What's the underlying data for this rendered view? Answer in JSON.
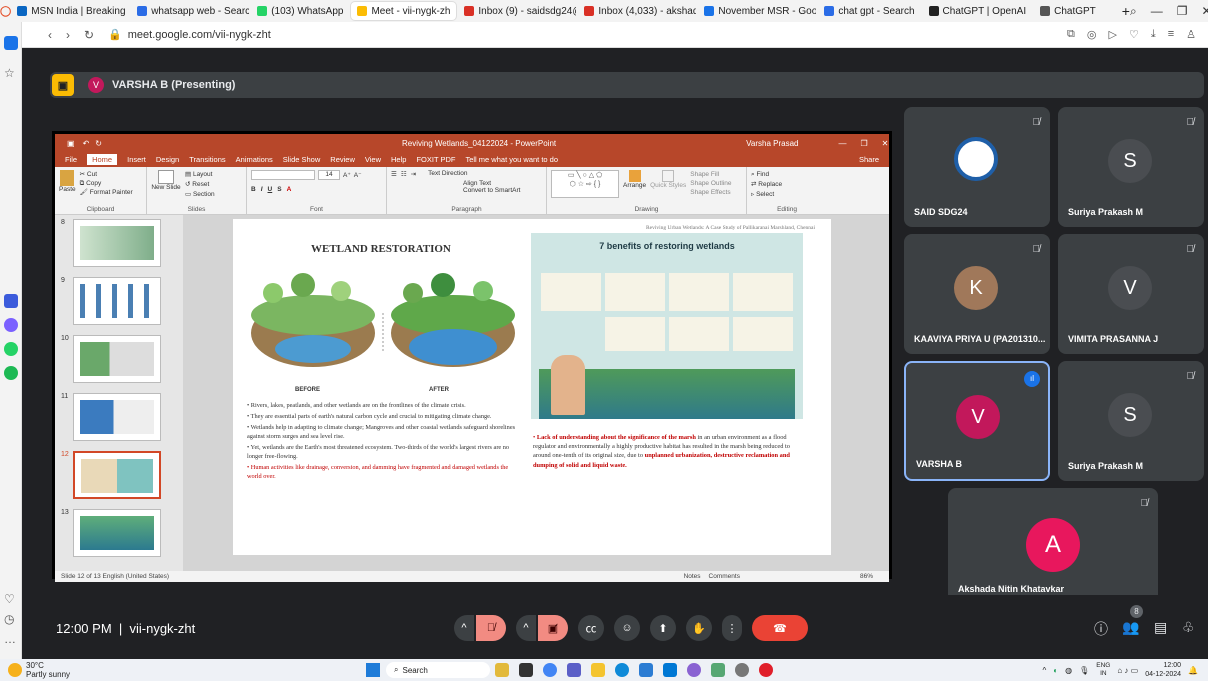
{
  "browser_tabs": [
    {
      "label": "MSN India | Breaking Ne",
      "color": "#0a66c2"
    },
    {
      "label": "whatsapp web - Search",
      "color": "#2b6ce6"
    },
    {
      "label": "(103) WhatsApp",
      "color": "#25d366"
    },
    {
      "label": "Meet - vii-nygk-zh",
      "color": "#fbbc04",
      "active": true
    },
    {
      "label": "Inbox (9) - saidsdg24@",
      "color": "#d93025"
    },
    {
      "label": "Inbox (4,033) - akshada",
      "color": "#d93025"
    },
    {
      "label": "November MSR - Goog",
      "color": "#1a73e8"
    },
    {
      "label": "chat gpt - Search",
      "color": "#2b6ce6"
    },
    {
      "label": "ChatGPT | OpenAI",
      "color": "#222222"
    },
    {
      "label": "ChatGPT",
      "color": "#555555"
    }
  ],
  "address": {
    "url": "meet.google.com/vii-nygk-zht"
  },
  "presenting": {
    "initial": "V",
    "label": "VARSHA B (Presenting)"
  },
  "ppt": {
    "title": "Reviving Wetlands_04122024 - PowerPoint",
    "user": "Varsha Prasad",
    "menu": [
      "File",
      "Home",
      "Insert",
      "Design",
      "Transitions",
      "Animations",
      "Slide Show",
      "Review",
      "View",
      "Help",
      "FOXIT PDF",
      "Tell me what you want to do"
    ],
    "share": "Share",
    "ribbon_groups": [
      "Clipboard",
      "Slides",
      "Font",
      "Paragraph",
      "Drawing",
      "Editing"
    ],
    "ribbon_items": {
      "paste": "Paste",
      "cut": "Cut",
      "copy": "Copy",
      "format_painter": "Format Painter",
      "new_slide": "New Slide",
      "layout": "Layout",
      "reset": "Reset",
      "section": "Section",
      "font_size": "14",
      "text_direction": "Text Direction",
      "align_text": "Align Text",
      "convert_smartart": "Convert to SmartArt",
      "arrange": "Arrange",
      "quick_styles": "Quick Styles",
      "shape_fill": "Shape Fill",
      "shape_outline": "Shape Outline",
      "shape_effects": "Shape Effects",
      "find": "Find",
      "replace": "Replace",
      "select": "Select"
    },
    "thumb_numbers": [
      "8",
      "9",
      "10",
      "11",
      "12",
      "13"
    ],
    "status": "Slide 12 of 13    English (United States)",
    "status_right": {
      "notes": "Notes",
      "comments": "Comments",
      "zoom": "86%"
    },
    "slide": {
      "ref": "Reviving Urban Wetlands: A Case Study of Pallikaranai Marshland, Chennai",
      "left_title": "WETLAND RESTORATION",
      "before": "BEFORE",
      "after": "AFTER",
      "right_title": "7 benefits of restoring wetlands",
      "bullets": [
        "Rivers, lakes, peatlands, and other wetlands are on the frontlines of the climate crisis.",
        "They are essential parts of earth's natural carbon cycle and crucial to mitigating climate change.",
        "Wetlands help in adapting to climate change; Mangroves and other coastal wetlands safeguard shorelines against storm surges and sea level rise.",
        "Yet, wetlands are the Earth's most threatened ecosystem. Two-thirds of the world's largest rivers are no longer free-flowing."
      ],
      "red_bullet": "Human activities like drainage, conversion, and damming have fragmented and damaged wetlands the world over.",
      "right_para_bold": "Lack of understanding about the significance of the marsh",
      "right_para_1": " in an urban environment as a flood regulator and environmentally a highly productive habitat has resulted in the marsh being reduced to around one-tenth of its original size, due to ",
      "right_para_bold2": "unplanned urbanization, destructive reclamation and dumping of solid and liquid waste."
    }
  },
  "participants": [
    {
      "name": "SAID SDG24",
      "initial": "",
      "color": "#ffffff"
    },
    {
      "name": "Suriya Prakash M",
      "initial": "S",
      "color": "#3c4043"
    },
    {
      "name": "KAAVIYA PRIYA U (PA201310...",
      "initial": "K",
      "color": "#a0785a"
    },
    {
      "name": "VIMITA PRASANNA J",
      "initial": "V",
      "color": "#3c4043"
    },
    {
      "name": "VARSHA B",
      "initial": "V",
      "color": "#c2185b"
    },
    {
      "name": "Suriya Prakash M",
      "initial": "S",
      "color": "#3c4043"
    },
    {
      "name": "Akshada Nitin Khatavkar",
      "initial": "A",
      "color": "#e8175d"
    }
  ],
  "meeting": {
    "time": "12:00 PM",
    "code": "vii-nygk-zht",
    "people_count": "8"
  },
  "taskbar": {
    "weather_temp": "30°C",
    "weather_desc": "Partly sunny",
    "search": "Search",
    "lang_top": "ENG",
    "lang_bottom": "IN",
    "clock_time": "12:00",
    "clock_date": "04-12-2024"
  }
}
